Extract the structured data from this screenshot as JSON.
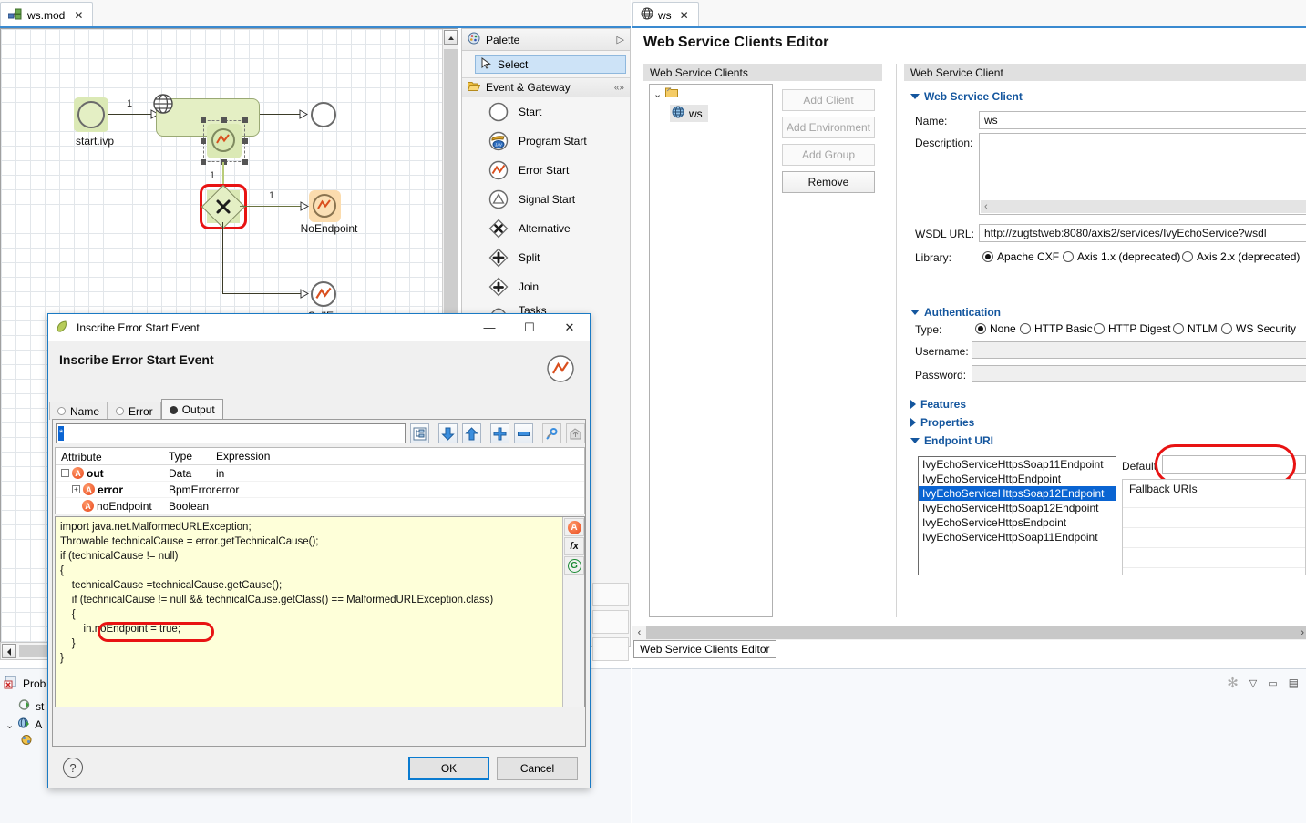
{
  "left_editor": {
    "tab_label": "ws.mod",
    "tab_icon": "process-model-icon",
    "close_icon": "✕"
  },
  "diagram": {
    "nodes": [
      {
        "id": "start",
        "label": "start.ivp",
        "type": "start-event"
      },
      {
        "id": "ws_task",
        "label": "",
        "type": "web-service-task"
      },
      {
        "id": "end",
        "label": "",
        "type": "end-event"
      },
      {
        "id": "error_boundary",
        "label": "",
        "type": "error-boundary-event"
      },
      {
        "id": "alternative",
        "label": "",
        "type": "alternative-gateway"
      },
      {
        "id": "noendpoint",
        "label": "NoEndpoint",
        "type": "error-end-event"
      },
      {
        "id": "callerror",
        "label": "CallError",
        "type": "error-end-event"
      }
    ],
    "flow_labels": [
      "1",
      "1",
      "1"
    ]
  },
  "palette": {
    "header": "Palette",
    "header_icon": "palette-icon",
    "expand_icon": "▷",
    "select_item": "Select",
    "select_icon": "cursor-icon",
    "group": "Event & Gateway",
    "group_icon": "folder-open-icon",
    "collapse_icon": "«»",
    "items": [
      {
        "label": "Start",
        "icon": "start-event-icon"
      },
      {
        "label": "Program Start",
        "icon": "program-start-icon"
      },
      {
        "label": "Error Start",
        "icon": "error-start-icon"
      },
      {
        "label": "Signal Start",
        "icon": "signal-start-icon"
      },
      {
        "label": "Alternative",
        "icon": "alternative-gateway-icon"
      },
      {
        "label": "Split",
        "icon": "split-gateway-icon"
      },
      {
        "label": "Join",
        "icon": "join-gateway-icon"
      },
      {
        "label": "Tasks",
        "icon": "tasks-icon"
      }
    ]
  },
  "right_editor": {
    "tab_label": "ws",
    "tab_icon": "globe-icon",
    "close_icon": "✕",
    "title": "Web Service Clients Editor",
    "bottom_tab": "Web Service Clients Editor",
    "clients_section": {
      "header": "Web Service Clients",
      "tree": {
        "root_icon": "folder-icon",
        "expander": "⌄",
        "child": {
          "label": "ws",
          "icon": "globe-icon"
        }
      },
      "buttons": [
        {
          "label": "Add Client",
          "enabled": false
        },
        {
          "label": "Add Environment",
          "enabled": false
        },
        {
          "label": "Add Group",
          "enabled": false
        },
        {
          "label": "Remove",
          "enabled": true
        }
      ]
    },
    "client_section": {
      "header": "Web Service Client",
      "group_title": "Web Service Client",
      "name_label": "Name:",
      "name_value": "ws",
      "description_label": "Description:",
      "description_value": "",
      "wsdl_label": "WSDL URL:",
      "wsdl_value": "http://zugtstweb:8080/axis2/services/IvyEchoService?wsdl",
      "library_label": "Library:",
      "library_options": [
        {
          "label": "Apache CXF",
          "selected": true
        },
        {
          "label": "Axis 1.x (deprecated)",
          "selected": false
        },
        {
          "label": "Axis 2.x (deprecated)",
          "selected": false
        }
      ]
    },
    "authentication": {
      "title": "Authentication",
      "type_label": "Type:",
      "type_options": [
        {
          "label": "None",
          "selected": true
        },
        {
          "label": "HTTP Basic",
          "selected": false
        },
        {
          "label": "HTTP Digest",
          "selected": false
        },
        {
          "label": "NTLM",
          "selected": false
        },
        {
          "label": "WS Security",
          "selected": false
        }
      ],
      "username_label": "Username:",
      "username_value": "",
      "password_label": "Password:",
      "password_value": ""
    },
    "collapsed_sections": [
      {
        "title": "Features"
      },
      {
        "title": "Properties"
      }
    ],
    "endpoint_uri": {
      "title": "Endpoint URI",
      "endpoints": [
        {
          "label": "IvyEchoServiceHttpsSoap11Endpoint",
          "selected": false
        },
        {
          "label": "IvyEchoServiceHttpEndpoint",
          "selected": false
        },
        {
          "label": "IvyEchoServiceHttpsSoap12Endpoint",
          "selected": true
        },
        {
          "label": "IvyEchoServiceHttpSoap12Endpoint",
          "selected": false
        },
        {
          "label": "IvyEchoServiceHttpsEndpoint",
          "selected": false
        },
        {
          "label": "IvyEchoServiceHttpSoap11Endpoint",
          "selected": false
        }
      ],
      "default_label": "Default",
      "default_value": "",
      "fallback_header": "Fallback URIs"
    }
  },
  "problems_view": {
    "title": "Prob",
    "icon": "problems-icon",
    "rows": [
      {
        "label": "st",
        "icon": "process-icon"
      },
      {
        "label": "A",
        "icon": "web-service-icon",
        "expander": "⌄"
      },
      {
        "label": "",
        "icon": "web-service-icon"
      }
    ]
  },
  "bottom_right_icons": [
    {
      "name": "build-icon",
      "glyph": "✻"
    },
    {
      "name": "chevron-down-icon",
      "glyph": "▽"
    },
    {
      "name": "minimize-icon",
      "glyph": "▭"
    },
    {
      "name": "maximize-icon",
      "glyph": "▤"
    }
  ],
  "dialog": {
    "window_title": "Inscribe Error Start Event",
    "window_icon": "ivy-leaf-icon",
    "minimize_glyph": "—",
    "maximize_glyph": "☐",
    "close_glyph": "✕",
    "heading": "Inscribe Error Start Event",
    "heading_icon": "error-start-icon",
    "tabs": [
      {
        "label": "Name",
        "active": false
      },
      {
        "label": "Error",
        "active": false
      },
      {
        "label": "Output",
        "active": true
      }
    ],
    "search_value": "*",
    "toolbar_buttons": [
      {
        "name": "tree-view-icon",
        "glyph": "▤"
      },
      {
        "name": "move-down-icon",
        "glyph": "⬇"
      },
      {
        "name": "move-up-icon",
        "glyph": "⬆"
      },
      {
        "name": "add-icon",
        "glyph": "✚"
      },
      {
        "name": "remove-icon",
        "glyph": "▬"
      },
      {
        "name": "link-icon",
        "glyph": "🔗"
      },
      {
        "name": "import-icon",
        "glyph": "⬆"
      }
    ],
    "table": {
      "columns": [
        "Attribute",
        "Type",
        "Expression"
      ],
      "rows": [
        {
          "attribute": "out",
          "type": "Data",
          "expression": "in",
          "indent": 0,
          "expander": "−",
          "bold": true
        },
        {
          "attribute": "error",
          "type": "BpmError",
          "expression": "error",
          "indent": 1,
          "expander": "+",
          "bold": true
        },
        {
          "attribute": "noEndpoint",
          "type": "Boolean",
          "expression": "",
          "indent": 1,
          "expander": "",
          "bold": false
        }
      ]
    },
    "code": "import java.net.MalformedURLException;\nThrowable technicalCause = error.getTechnicalCause();\nif (technicalCause != null)\n{\n    technicalCause =technicalCause.getCause();\n    if (technicalCause != null && technicalCause.getClass() == MalformedURLException.class)\n    {\n        in.noEndpoint = true;\n    }\n}",
    "code_side_buttons": [
      {
        "name": "attribute-icon",
        "glyph": "A"
      },
      {
        "name": "function-icon",
        "glyph": "fx"
      },
      {
        "name": "global-icon",
        "glyph": "G"
      }
    ],
    "help_glyph": "?",
    "ok_label": "OK",
    "cancel_label": "Cancel"
  },
  "colors": {
    "accent_blue": "#0a64d2",
    "highlight_red": "#e81313",
    "bpmn_green": "#e4efc4",
    "bpmn_orange": "#fbe0b6",
    "code_bg": "#feffd9",
    "link_blue": "#14569e"
  }
}
